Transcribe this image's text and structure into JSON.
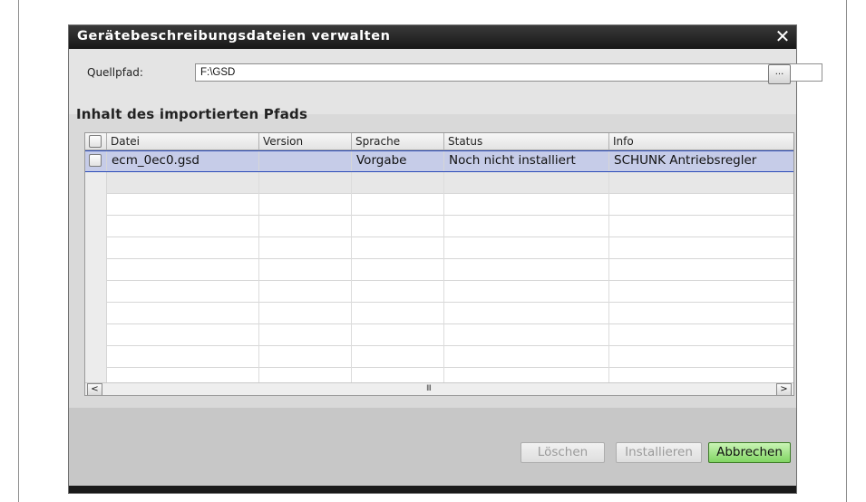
{
  "dialog": {
    "title": "Gerätebeschreibungsdateien verwalten",
    "close_glyph": "✕"
  },
  "source": {
    "label": "Quellpfad:",
    "value": "F:\\GSD",
    "browse_label": "..."
  },
  "section": {
    "title": "Inhalt des importierten Pfads"
  },
  "table": {
    "columns": [
      "Datei",
      "Version",
      "Sprache",
      "Status",
      "Info"
    ],
    "rows": [
      {
        "selected": true,
        "checked": false,
        "cells": [
          "ecm_0ec0.gsd",
          "",
          "Vorgabe",
          "Noch nicht installiert",
          "SCHUNK Antriebsregler"
        ]
      }
    ]
  },
  "scrollbar": {
    "left_glyph": "<",
    "right_glyph": ">",
    "grip_glyph": "III"
  },
  "buttons": {
    "delete_label": "Löschen",
    "install_label": "Installieren",
    "cancel_label": "Abbrechen"
  },
  "colors": {
    "titlebar": "#1f1f1f",
    "selection": "#c6cce8",
    "primary_button": "#9ae07c"
  }
}
